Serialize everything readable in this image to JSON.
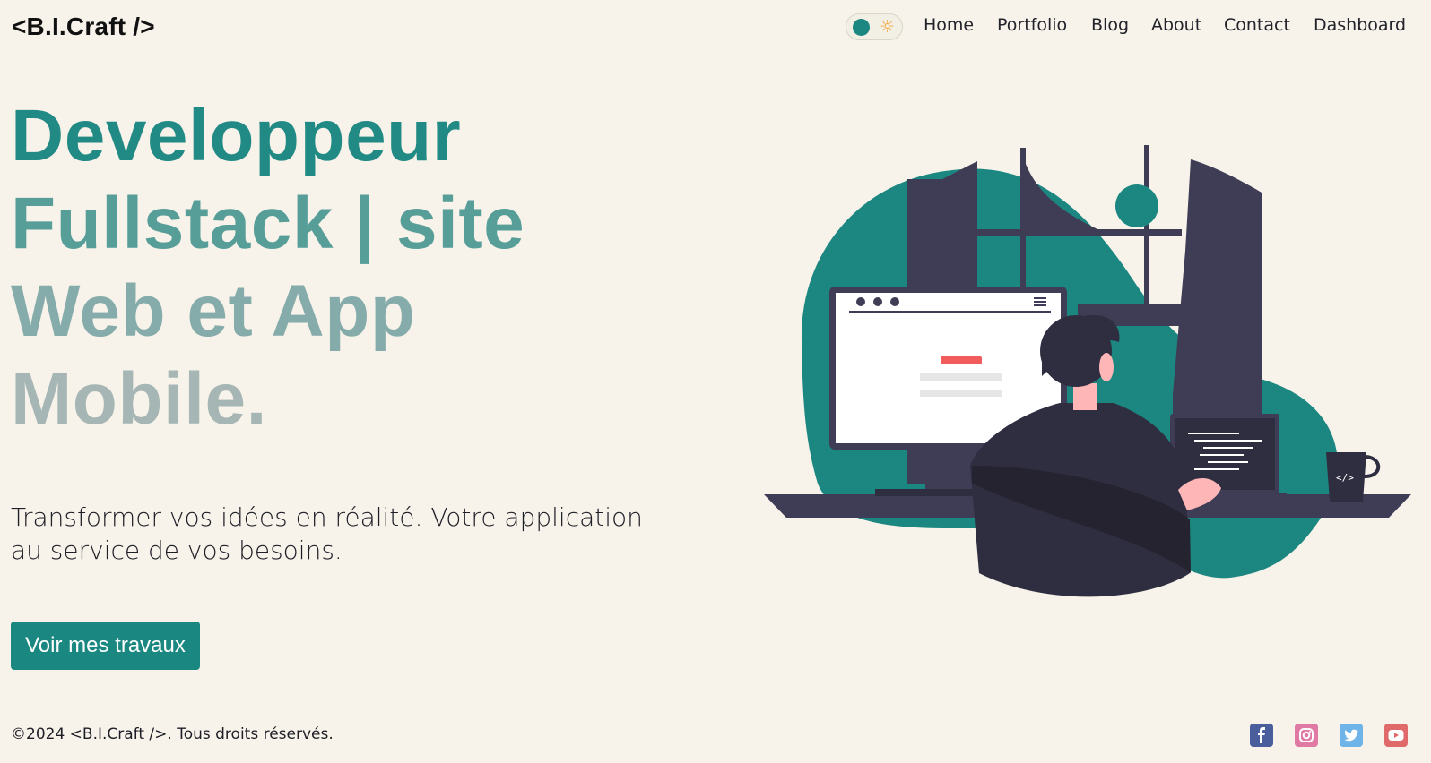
{
  "header": {
    "logo": "<B.I.Craft />",
    "theme_toggle": {
      "knob_color": "#1b8780",
      "sun_icon": "☼",
      "state": "light"
    },
    "nav": [
      {
        "label": "Home"
      },
      {
        "label": "Portfolio"
      },
      {
        "label": "Blog"
      },
      {
        "label": "About"
      },
      {
        "label": "Contact"
      },
      {
        "label": "Dashboard"
      }
    ]
  },
  "hero": {
    "title_lines": [
      "Developpeur",
      "Fullstack | site",
      "Web et App",
      "Mobile."
    ],
    "subtitle": "Transformer vos idées en réalité. Votre application au service de vos besoins.",
    "cta_label": "Voir mes travaux",
    "illustration": {
      "name": "developer-at-desk-illustration",
      "screen_code_label": "</>"
    }
  },
  "footer": {
    "copyright": "©2024 <B.I.Craft />. Tous droits réservés.",
    "social": [
      {
        "icon": "facebook-icon",
        "color": "#4267b2"
      },
      {
        "icon": "instagram-icon",
        "color": "#e4405f"
      },
      {
        "icon": "twitter-icon",
        "color": "#1da1f2"
      },
      {
        "icon": "youtube-icon",
        "color": "#ff0000"
      }
    ]
  },
  "colors": {
    "background": "#f7f2ea",
    "accent": "#1a8780",
    "dark": "#3f3d56"
  }
}
